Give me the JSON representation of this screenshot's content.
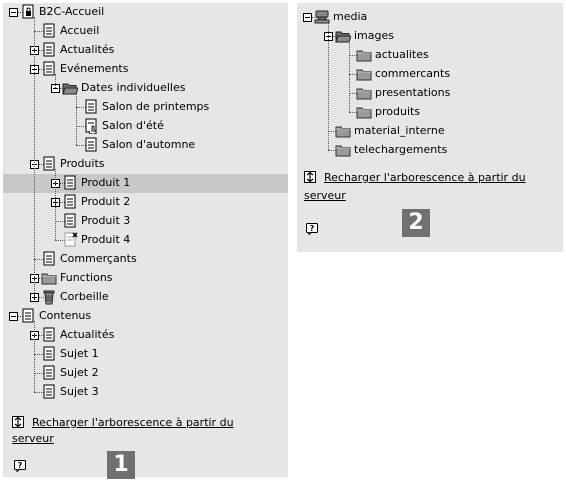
{
  "panel1": {
    "tree": [
      {
        "label": "B2C-Accueil",
        "icon": "page-locked-icon",
        "expander": "minus"
      },
      {
        "label": "Accueil",
        "icon": "page-icon",
        "expander": null
      },
      {
        "label": "Actualités",
        "icon": "page-icon",
        "expander": "plus"
      },
      {
        "label": "Evénements",
        "icon": "page-icon",
        "expander": "minus"
      },
      {
        "label": "Dates individuelles",
        "icon": "folder-open-icon",
        "expander": "minus"
      },
      {
        "label": "Salon de printemps",
        "icon": "page-icon",
        "expander": null
      },
      {
        "label": "Salon d'été",
        "icon": "page-hand-cursor-icon",
        "expander": null
      },
      {
        "label": "Salon d'automne",
        "icon": "page-icon",
        "expander": null
      },
      {
        "label": "Produits",
        "icon": "page-icon",
        "expander": "minus"
      },
      {
        "label": "Produit 1",
        "icon": "page-icon",
        "expander": "plus",
        "selected": true
      },
      {
        "label": "Produit 2",
        "icon": "page-icon",
        "expander": "plus"
      },
      {
        "label": "Produit 3",
        "icon": "page-icon",
        "expander": null
      },
      {
        "label": "Produit 4",
        "icon": "page-deleted-icon",
        "expander": null
      },
      {
        "label": "Commerçants",
        "icon": "page-icon",
        "expander": null
      },
      {
        "label": "Functions",
        "icon": "folder-icon",
        "expander": "plus"
      },
      {
        "label": "Corbeille",
        "icon": "recycle-bin-icon",
        "expander": "plus"
      },
      {
        "label": "Contenus",
        "icon": "page-icon",
        "expander": "minus"
      },
      {
        "label": "Actualités",
        "icon": "page-icon",
        "expander": "plus"
      },
      {
        "label": "Sujet 1",
        "icon": "page-icon",
        "expander": null
      },
      {
        "label": "Sujet 2",
        "icon": "page-icon",
        "expander": null
      },
      {
        "label": "Sujet 3",
        "icon": "page-icon",
        "expander": null
      }
    ],
    "reload_line1": "Recharger l'arborescence à partir du",
    "reload_line2": "serveur",
    "badge": "1"
  },
  "panel2": {
    "tree": [
      {
        "label": "media",
        "icon": "server-icon",
        "expander": "minus"
      },
      {
        "label": "images",
        "icon": "folder-open-icon",
        "expander": "minus"
      },
      {
        "label": "actualites",
        "icon": "folder-icon",
        "expander": null
      },
      {
        "label": "commercants",
        "icon": "folder-icon",
        "expander": null
      },
      {
        "label": "presentations",
        "icon": "folder-icon",
        "expander": null
      },
      {
        "label": "produits",
        "icon": "folder-icon",
        "expander": null
      },
      {
        "label": "material_interne",
        "icon": "folder-icon",
        "expander": null
      },
      {
        "label": "telechargements",
        "icon": "folder-icon",
        "expander": null
      }
    ],
    "reload_line1": "Recharger l'arborescence à partir du",
    "reload_line2": "serveur",
    "badge": "2"
  },
  "colors": {
    "panel_bg": "#e6e6e6",
    "selected_row": "#c8c8c8",
    "badge_bg": "#707070",
    "badge_text": "#ffffff"
  }
}
